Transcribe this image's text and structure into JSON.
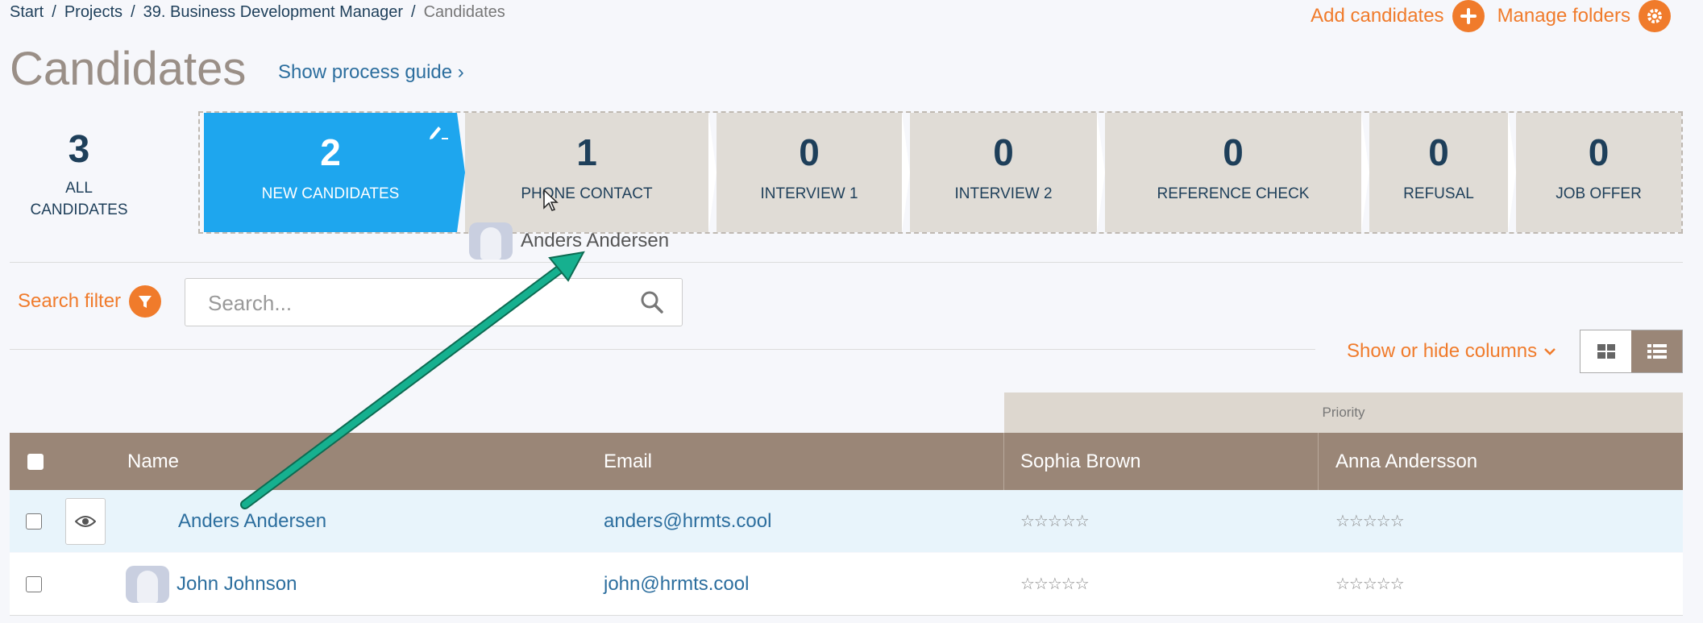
{
  "breadcrumb": [
    "Start",
    "Projects",
    "39. Business Development Manager",
    "Candidates"
  ],
  "header": {
    "add_candidates": "Add candidates",
    "manage_folders": "Manage folders",
    "title": "Candidates",
    "process_guide": "Show process guide ›"
  },
  "pipeline": {
    "all": {
      "count": "3",
      "label_line1": "ALL",
      "label_line2": "CANDIDATES"
    },
    "stages": [
      {
        "count": "2",
        "label": "NEW CANDIDATES",
        "active": true
      },
      {
        "count": "1",
        "label": "PHONE CONTACT"
      },
      {
        "count": "0",
        "label": "INTERVIEW 1"
      },
      {
        "count": "0",
        "label": "INTERVIEW 2"
      },
      {
        "count": "0",
        "label": "REFERENCE CHECK"
      },
      {
        "count": "0",
        "label": "REFUSAL"
      },
      {
        "count": "0",
        "label": "JOB OFFER"
      }
    ]
  },
  "drag_ghost": {
    "name": "Anders Andersen"
  },
  "search": {
    "filter_label": "Search filter",
    "placeholder": "Search..."
  },
  "columns_toggle": {
    "label": "Show or hide columns"
  },
  "table": {
    "group_header": "Priority",
    "headers": {
      "name": "Name",
      "email": "Email",
      "reviewer1": "Sophia Brown",
      "reviewer2": "Anna Andersson"
    },
    "rows": [
      {
        "name": "Anders Andersen",
        "email": "anders@hrmts.cool",
        "rating1": "☆☆☆☆☆",
        "rating2": "☆☆☆☆☆"
      },
      {
        "name": "John Johnson",
        "email": "john@hrmts.cool",
        "rating1": "☆☆☆☆☆",
        "rating2": "☆☆☆☆☆"
      }
    ]
  },
  "colors": {
    "accent": "#f07b2b",
    "active_stage": "#1ea6ee",
    "table_header": "#9a8677",
    "link": "#2c6e9e"
  },
  "icons": [
    "plus-icon",
    "gear-icon",
    "pencil-icon",
    "filter-icon",
    "search-icon",
    "chevron-down-icon",
    "grid-view-icon",
    "list-view-icon",
    "eye-icon"
  ]
}
